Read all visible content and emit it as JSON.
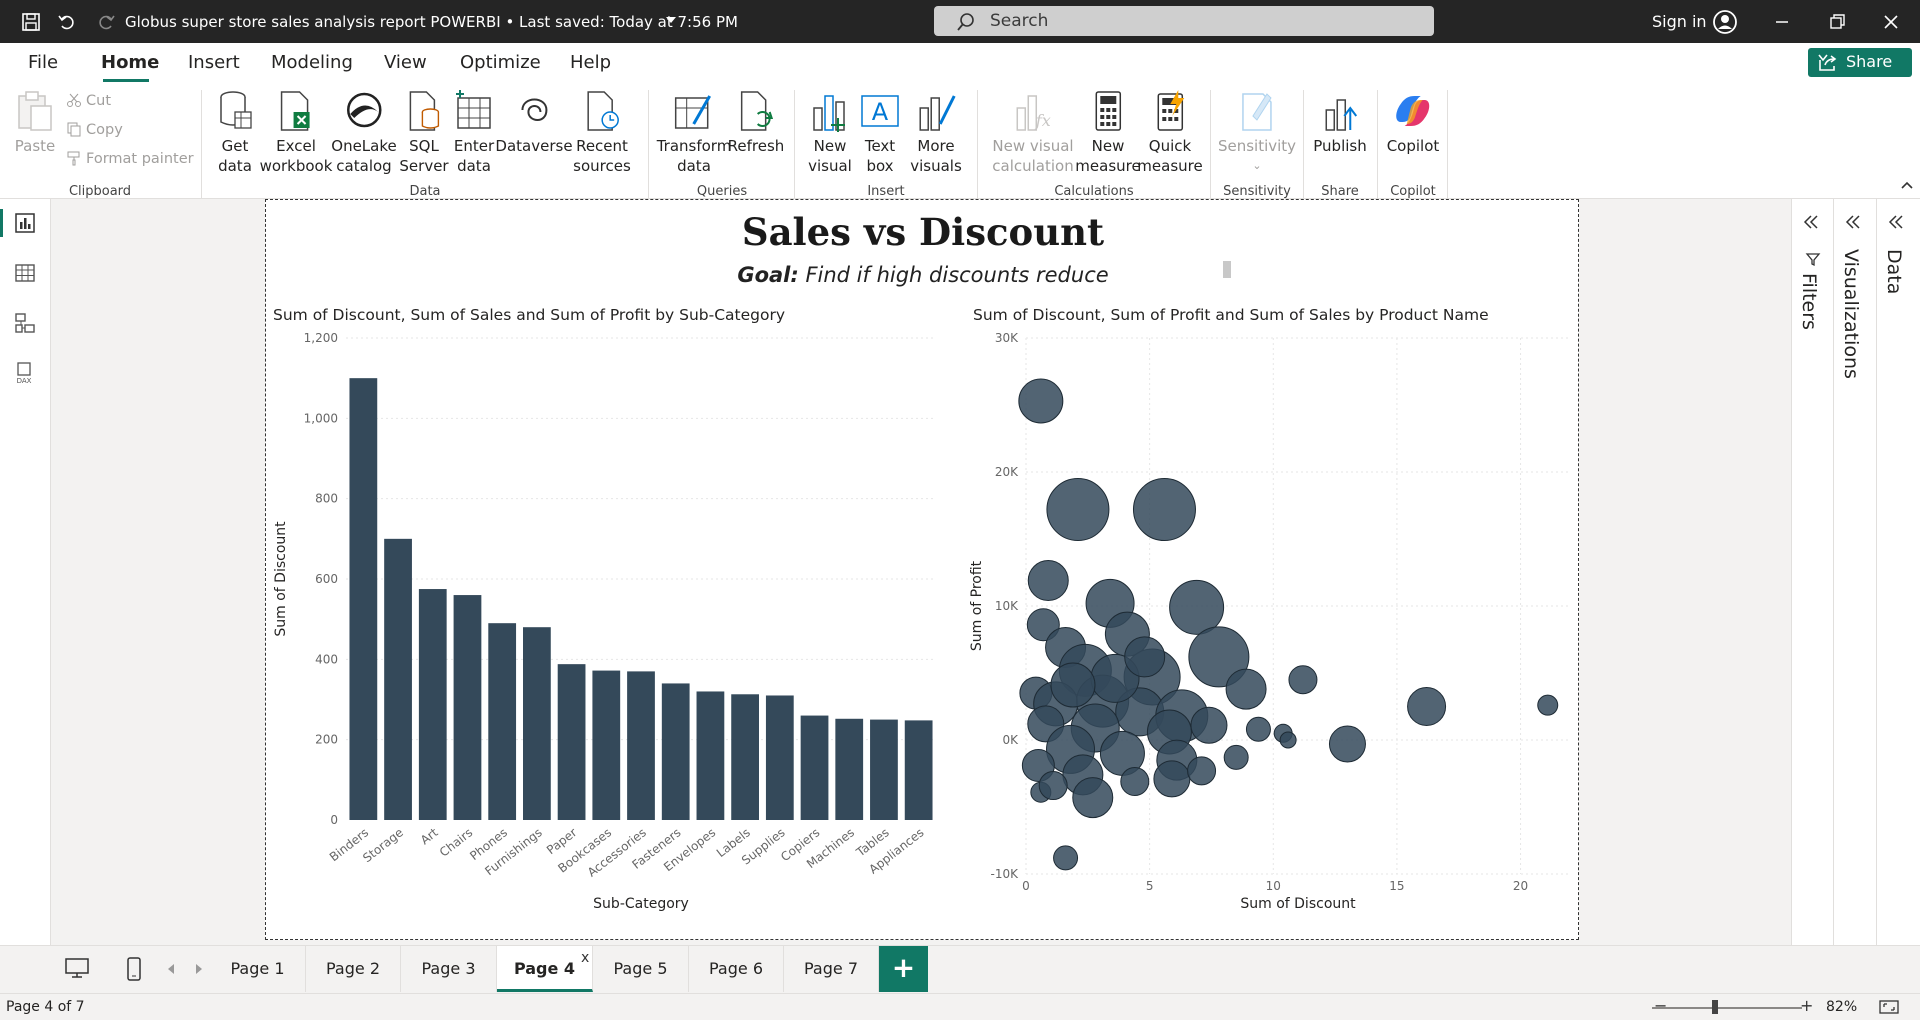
{
  "window": {
    "title": "Globus super store sales analysis report POWERBI",
    "saved_status": " • Last saved: Today at 7:56 PM",
    "search_placeholder": "Search",
    "sign_in": "Sign in"
  },
  "menu": {
    "items": [
      "File",
      "Home",
      "Insert",
      "Modeling",
      "View",
      "Optimize",
      "Help"
    ],
    "active": "Home",
    "share_label": "Share"
  },
  "ribbon": {
    "clipboard": {
      "paste": "Paste",
      "cut": "Cut",
      "copy": "Copy",
      "format_painter": "Format painter",
      "group": "Clipboard"
    },
    "data": {
      "buttons": [
        [
          "Get",
          "data"
        ],
        [
          "Excel",
          "workbook"
        ],
        [
          "OneLake",
          "catalog"
        ],
        [
          "SQL",
          "Server"
        ],
        [
          "Enter",
          "data"
        ],
        [
          "Dataverse",
          ""
        ],
        [
          "Recent",
          "sources"
        ]
      ],
      "group": "Data"
    },
    "queries": {
      "buttons": [
        [
          "Transform",
          "data"
        ],
        [
          "Refresh",
          ""
        ]
      ],
      "group": "Queries"
    },
    "insert": {
      "buttons": [
        [
          "New",
          "visual"
        ],
        [
          "Text",
          "box"
        ],
        [
          "More",
          "visuals"
        ]
      ],
      "group": "Insert"
    },
    "calculations": {
      "buttons": [
        [
          "New visual",
          "calculation"
        ],
        [
          "New",
          "measure"
        ],
        [
          "Quick",
          "measure"
        ]
      ],
      "group": "Calculations"
    },
    "sensitivity": {
      "buttons": [
        [
          "Sensitivity",
          ""
        ]
      ],
      "group": "Sensitivity"
    },
    "share": {
      "buttons": [
        [
          "Publish",
          ""
        ]
      ],
      "group": "Share"
    },
    "copilot": {
      "buttons": [
        [
          "Copilot",
          ""
        ]
      ],
      "group": "Copilot"
    }
  },
  "report": {
    "title": "Sales vs Discount",
    "goal_label": "Goal:",
    "goal_text": " Find if high discounts reduce"
  },
  "panes": {
    "filters": "Filters",
    "visualizations": "Visualizations",
    "data": "Data"
  },
  "tabs": {
    "pages": [
      "Page 1",
      "Page 2",
      "Page 3",
      "Page 4",
      "Page 5",
      "Page 6",
      "Page 7"
    ],
    "active": "Page 4",
    "close_glyph": "x",
    "add_glyph": "+"
  },
  "status": {
    "page_indicator": "Page 4 of 7",
    "zoom": "82%",
    "zoom_level": 0.42
  },
  "colors": {
    "accent": "#117865",
    "bar": "#34495a",
    "bubble": "#34495a"
  },
  "icons": [
    "save-icon",
    "undo-icon",
    "redo-icon",
    "search-icon",
    "user-icon",
    "minimize-icon",
    "restore-icon",
    "close-icon",
    "share-icon"
  ],
  "chart_data": [
    {
      "type": "bar",
      "title": "Sum of Discount, Sum of Sales and Sum of Profit by Sub-Category",
      "xlabel": "Sub-Category",
      "ylabel": "Sum of Discount",
      "ylim": [
        0,
        1200
      ],
      "yticks": [
        0,
        200,
        400,
        600,
        800,
        1000,
        1200
      ],
      "ytick_labels": [
        "0",
        "200",
        "400",
        "600",
        "800",
        "1,000",
        "1,200"
      ],
      "grid": true,
      "categories": [
        "Binders",
        "Storage",
        "Art",
        "Chairs",
        "Phones",
        "Furnishings",
        "Paper",
        "Bookcases",
        "Accessories",
        "Fasteners",
        "Envelopes",
        "Labels",
        "Supplies",
        "Copiers",
        "Machines",
        "Tables",
        "Appliances"
      ],
      "values": [
        1100,
        700,
        575,
        560,
        490,
        480,
        388,
        372,
        370,
        340,
        320,
        313,
        310,
        260,
        252,
        250,
        248
      ]
    },
    {
      "type": "scatter",
      "title": "Sum of Discount, Sum of Profit and Sum of Sales by Product Name",
      "xlabel": "Sum of Discount",
      "ylabel": "Sum of Profit",
      "xlim": [
        0,
        22
      ],
      "ylim": [
        -10000,
        30000
      ],
      "xticks": [
        0,
        5,
        10,
        15,
        20
      ],
      "xtick_labels": [
        "0",
        "5",
        "10",
        "15",
        "20"
      ],
      "yticks": [
        -10000,
        0,
        10000,
        20000,
        30000
      ],
      "ytick_labels": [
        "-10K",
        "0K",
        "10K",
        "20K",
        "30K"
      ],
      "grid": true,
      "points": [
        {
          "x": 0.6,
          "y": 25300,
          "size": 22
        },
        {
          "x": 2.1,
          "y": 17200,
          "size": 31
        },
        {
          "x": 5.6,
          "y": 17200,
          "size": 31
        },
        {
          "x": 0.9,
          "y": 11900,
          "size": 20
        },
        {
          "x": 3.4,
          "y": 10200,
          "size": 24
        },
        {
          "x": 6.9,
          "y": 9900,
          "size": 27
        },
        {
          "x": 0.7,
          "y": 8600,
          "size": 16
        },
        {
          "x": 4.1,
          "y": 7900,
          "size": 22
        },
        {
          "x": 1.6,
          "y": 6900,
          "size": 20
        },
        {
          "x": 7.8,
          "y": 6200,
          "size": 30
        },
        {
          "x": 2.4,
          "y": 5200,
          "size": 26
        },
        {
          "x": 5.1,
          "y": 4700,
          "size": 28
        },
        {
          "x": 8.9,
          "y": 3800,
          "size": 20
        },
        {
          "x": 11.2,
          "y": 4500,
          "size": 14
        },
        {
          "x": 16.2,
          "y": 2500,
          "size": 19
        },
        {
          "x": 21.1,
          "y": 2600,
          "size": 10
        },
        {
          "x": 0.4,
          "y": 3500,
          "size": 16
        },
        {
          "x": 1.2,
          "y": 2700,
          "size": 22
        },
        {
          "x": 3.1,
          "y": 2900,
          "size": 26
        },
        {
          "x": 4.6,
          "y": 2100,
          "size": 24
        },
        {
          "x": 6.3,
          "y": 1800,
          "size": 26
        },
        {
          "x": 2.8,
          "y": 900,
          "size": 24
        },
        {
          "x": 0.8,
          "y": 1200,
          "size": 18
        },
        {
          "x": 5.8,
          "y": 600,
          "size": 22
        },
        {
          "x": 7.4,
          "y": 1100,
          "size": 18
        },
        {
          "x": 9.4,
          "y": 800,
          "size": 12
        },
        {
          "x": 10.4,
          "y": 500,
          "size": 9
        },
        {
          "x": 10.6,
          "y": 0,
          "size": 8
        },
        {
          "x": 13.0,
          "y": -300,
          "size": 18
        },
        {
          "x": 1.8,
          "y": -700,
          "size": 24
        },
        {
          "x": 3.9,
          "y": -1000,
          "size": 22
        },
        {
          "x": 6.1,
          "y": -1500,
          "size": 20
        },
        {
          "x": 8.5,
          "y": -1300,
          "size": 12
        },
        {
          "x": 0.5,
          "y": -1900,
          "size": 16
        },
        {
          "x": 2.3,
          "y": -2600,
          "size": 20
        },
        {
          "x": 4.4,
          "y": -3100,
          "size": 14
        },
        {
          "x": 5.9,
          "y": -2900,
          "size": 18
        },
        {
          "x": 7.1,
          "y": -2300,
          "size": 14
        },
        {
          "x": 0.6,
          "y": -3900,
          "size": 10
        },
        {
          "x": 2.7,
          "y": -4300,
          "size": 20
        },
        {
          "x": 1.1,
          "y": -3400,
          "size": 14
        },
        {
          "x": 1.6,
          "y": -8800,
          "size": 12
        },
        {
          "x": 3.6,
          "y": 4600,
          "size": 24
        },
        {
          "x": 4.8,
          "y": 6200,
          "size": 20
        },
        {
          "x": 1.9,
          "y": 4100,
          "size": 22
        }
      ]
    }
  ]
}
